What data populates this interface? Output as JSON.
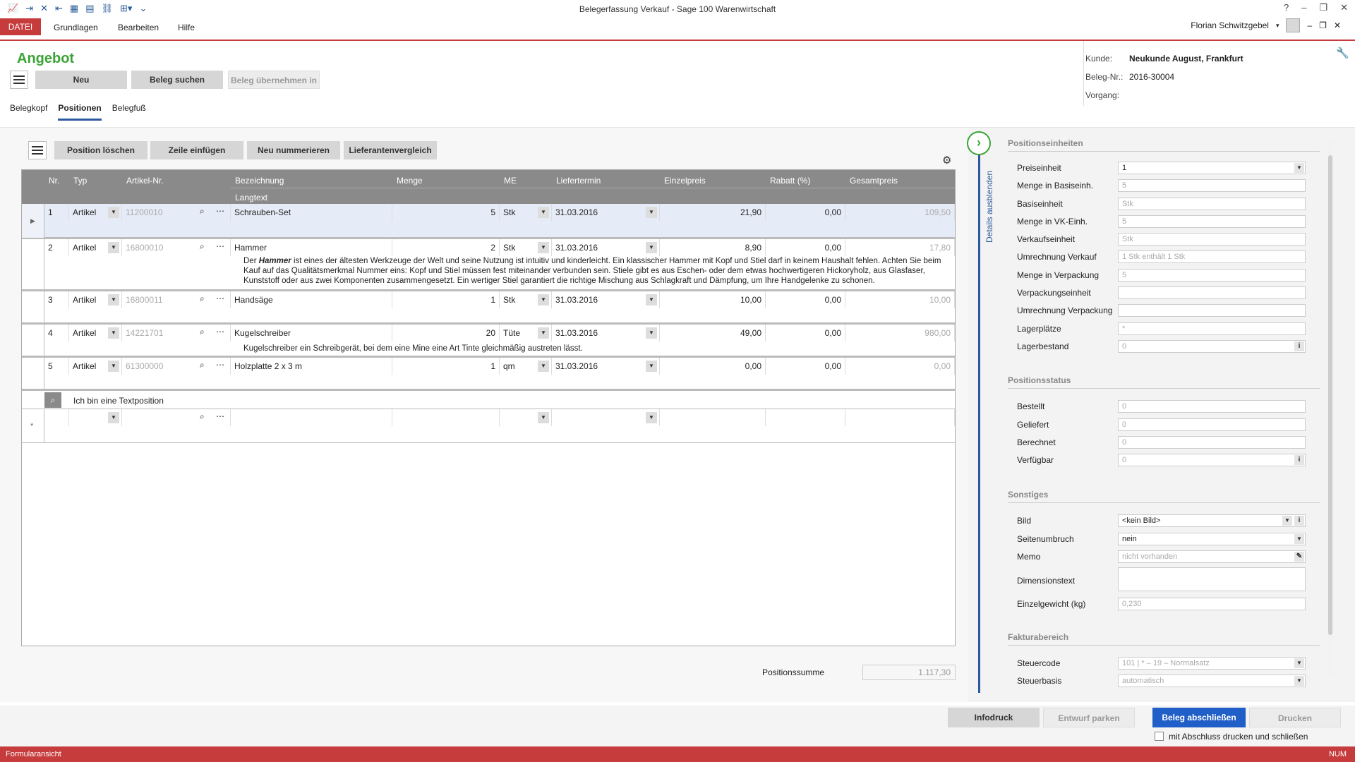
{
  "window": {
    "title": "Belegerfassung Verkauf - Sage 100 Warenwirtschaft"
  },
  "menu": {
    "datei": "DATEI",
    "items": [
      "Grundlagen",
      "Bearbeiten",
      "Hilfe"
    ]
  },
  "user": {
    "name": "Florian Schwitzgebel",
    "help": "?"
  },
  "page": {
    "title": "Angebot"
  },
  "toolbar": {
    "neu": "Neu",
    "beleg_suchen": "Beleg suchen",
    "beleg_uebernehmen": "Beleg übernehmen in"
  },
  "tabs": [
    "Belegkopf",
    "Positionen",
    "Belegfuß"
  ],
  "kunde": {
    "kunde_label": "Kunde:",
    "kunde": "Neukunde August, Frankfurt",
    "belegnr_label": "Beleg-Nr.:",
    "belegnr": "2016-30004",
    "vorgang_label": "Vorgang:"
  },
  "gridtoolbar": {
    "position_loeschen": "Position löschen",
    "zeile_einfuegen": "Zeile einfügen",
    "neu_nummerieren": "Neu nummerieren",
    "lieferantenvergleich": "Lieferantenvergleich"
  },
  "columns": {
    "nr": "Nr.",
    "typ": "Typ",
    "artikelnr": "Artikel-Nr.",
    "bezeichnung": "Bezeichnung",
    "langtext": "Langtext",
    "menge": "Menge",
    "me": "ME",
    "liefertermin": "Liefertermin",
    "einzelpreis": "Einzelpreis",
    "rabatt": "Rabatt (%)",
    "gesamtpreis": "Gesamtpreis"
  },
  "rows": [
    {
      "nr": "1",
      "typ": "Artikel",
      "artikelnr": "11200010",
      "bezeichnung": "Schrauben-Set",
      "menge": "5",
      "me": "Stk",
      "liefertermin": "31.03.2016",
      "einzelpreis": "21,90",
      "rabatt": "0,00",
      "gesamtpreis": "109,50",
      "langtext": ""
    },
    {
      "nr": "2",
      "typ": "Artikel",
      "artikelnr": "16800010",
      "bezeichnung": "Hammer",
      "menge": "2",
      "me": "Stk",
      "liefertermin": "31.03.2016",
      "einzelpreis": "8,90",
      "rabatt": "0,00",
      "gesamtpreis": "17,80",
      "langtext_pre": "Der ",
      "langtext_bold": "Hammer",
      "langtext": " ist eines der ältesten Werkzeuge der Welt und seine Nutzung ist intuitiv und kinderleicht. Ein klassischer Hammer mit Kopf und Stiel darf in keinem Haushalt fehlen. Achten Sie beim Kauf auf das Qualitätsmerkmal Nummer eins: Kopf und Stiel müssen fest miteinander verbunden sein. Stiele gibt es aus Eschen- oder dem etwas hochwertigeren Hickoryholz, aus Glasfaser, Kunststoff oder aus zwei Komponenten zusammengesetzt. Ein wertiger Stiel garantiert die richtige Mischung aus Schlagkraft und Dämpfung, um Ihre Handgelenke zu schonen."
    },
    {
      "nr": "3",
      "typ": "Artikel",
      "artikelnr": "16800011",
      "bezeichnung": "Handsäge",
      "menge": "1",
      "me": "Stk",
      "liefertermin": "31.03.2016",
      "einzelpreis": "10,00",
      "rabatt": "0,00",
      "gesamtpreis": "10,00",
      "langtext": ""
    },
    {
      "nr": "4",
      "typ": "Artikel",
      "artikelnr": "14221701",
      "bezeichnung": "Kugelschreiber",
      "menge": "20",
      "me": "Tüte",
      "liefertermin": "31.03.2016",
      "einzelpreis": "49,00",
      "rabatt": "0,00",
      "gesamtpreis": "980,00",
      "langtext": "Kugelschreiber ein Schreibgerät, bei dem eine Mine eine Art Tinte gleichmäßig austreten lässt."
    },
    {
      "nr": "5",
      "typ": "Artikel",
      "artikelnr": "61300000",
      "bezeichnung": "Holzplatte 2 x 3 m",
      "menge": "1",
      "me": "qm",
      "liefertermin": "31.03.2016",
      "einzelpreis": "0,00",
      "rabatt": "0,00",
      "gesamtpreis": "0,00",
      "langtext": ""
    }
  ],
  "textposition": "Ich bin eine Textposition",
  "summe": {
    "label": "Positionssumme",
    "value": "1.117,30"
  },
  "side": {
    "toggle": "Details ausblenden",
    "sec1": "Positionseinheiten",
    "fields1": [
      {
        "label": "Preiseinheit",
        "value": "1"
      },
      {
        "label": "Menge in Basiseinh.",
        "value": "5"
      },
      {
        "label": "Basiseinheit",
        "value": "Stk"
      },
      {
        "label": "Menge in VK-Einh.",
        "value": "5"
      },
      {
        "label": "Verkaufseinheit",
        "value": "Stk"
      },
      {
        "label": "Umrechnung Verkauf",
        "value": "1 Stk enthält 1 Stk"
      },
      {
        "label": "Menge in Verpackung",
        "value": "5"
      },
      {
        "label": "Verpackungseinheit",
        "value": ""
      },
      {
        "label": "Umrechnung Verpackung",
        "value": ""
      },
      {
        "label": "Lagerplätze",
        "value": "*"
      },
      {
        "label": "Lagerbestand",
        "value": "0"
      }
    ],
    "sec2": "Positionsstatus",
    "fields2": [
      {
        "label": "Bestellt",
        "value": "0"
      },
      {
        "label": "Geliefert",
        "value": "0"
      },
      {
        "label": "Berechnet",
        "value": "0"
      },
      {
        "label": "Verfügbar",
        "value": "0"
      }
    ],
    "sec3": "Sonstiges",
    "fields3": [
      {
        "label": "Bild",
        "value": "<kein Bild>"
      },
      {
        "label": "Seitenumbruch",
        "value": "nein"
      },
      {
        "label": "Memo",
        "value": "nicht vorhanden"
      },
      {
        "label": "Dimensionstext",
        "value": ""
      },
      {
        "label": "Einzelgewicht (kg)",
        "value": "0,230"
      }
    ],
    "sec4": "Fakturabereich",
    "fields4": [
      {
        "label": "Steuercode",
        "value": "101  |  *  –  19  –  Normalsatz"
      },
      {
        "label": "Steuerbasis",
        "value": "automatisch"
      }
    ]
  },
  "footer": {
    "infodruck": "Infodruck",
    "entwurf": "Entwurf parken",
    "abschliessen": "Beleg abschließen",
    "drucken": "Drucken",
    "checkbox": "mit Abschluss drucken und schließen"
  },
  "status": {
    "left": "Formularansicht",
    "right": "NUM"
  }
}
